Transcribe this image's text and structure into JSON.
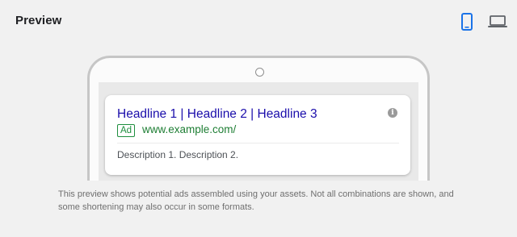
{
  "header": {
    "title": "Preview"
  },
  "devices": {
    "mobile_icon": "smartphone-icon",
    "desktop_icon": "laptop-icon",
    "selected": "mobile",
    "selected_color": "#1a73e8",
    "unselected_color": "#5f6368"
  },
  "ad": {
    "headline": "Headline 1 | Headline 2 | Headline 3",
    "badge": "Ad",
    "display_url": "www.example.com/",
    "description": "Description 1. Description 2.",
    "info_icon": "info-icon",
    "info_glyph": "i"
  },
  "footnote": "This preview shows potential ads assembled using your assets. Not all combinations are shown, and some shortening may also occur in some formats."
}
